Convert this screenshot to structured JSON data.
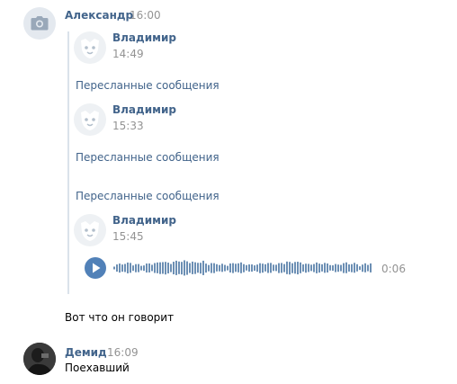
{
  "message1": {
    "author": "Александр",
    "time": "16:00",
    "avatar_icon": "camera-icon",
    "forwarded": [
      {
        "author": "Владимир",
        "time": "14:49"
      },
      {
        "label": "Пересланные сообщения"
      },
      {
        "author": "Владимир",
        "time": "15:33"
      },
      {
        "label": "Пересланные сообщения"
      },
      {
        "label": "Пересланные сообщения"
      },
      {
        "author": "Владимир",
        "time": "15:45"
      }
    ],
    "audio": {
      "duration": "0:06",
      "icon": "play-icon"
    },
    "text": "Вот что он говорит"
  },
  "message2": {
    "author": "Демид",
    "time": "16:09",
    "text": "Поехавший"
  },
  "colors": {
    "link": "#42648b",
    "accent": "#5181b8",
    "muted": "#939393"
  }
}
